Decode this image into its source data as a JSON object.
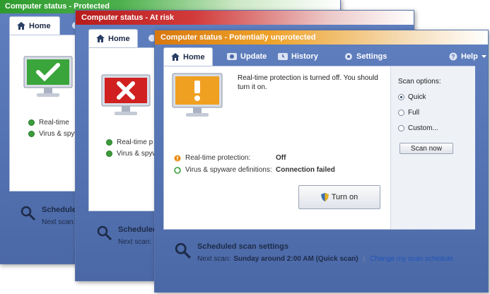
{
  "windows": {
    "protected": {
      "title": "Computer status - Protected",
      "tab_home": "Home",
      "rows": [
        "Real-time",
        "Virus & spyw"
      ],
      "scheduled": "Scheduled",
      "next_scan": "Next scan: S"
    },
    "at_risk": {
      "title": "Computer status - At risk",
      "tab_home": "Home",
      "rows": [
        "Real-time p",
        "Virus & spyw"
      ],
      "scheduled": "Scheduled s",
      "next_scan": "Next scan: S"
    },
    "unprotected": {
      "title": "Computer status - Potentially unprotected",
      "tabs": {
        "home": "Home",
        "update": "Update",
        "history": "History",
        "settings": "Settings",
        "help": "Help"
      },
      "message": "Real-time protection is turned off. You should turn it on.",
      "realtime_label": "Real-time protection:",
      "realtime_value": "Off",
      "defs_label": "Virus & spyware definitions:",
      "defs_value": "Connection failed",
      "turn_on": "Turn on",
      "scan_options": {
        "title": "Scan options:",
        "options": [
          "Quick",
          "Full",
          "Custom..."
        ],
        "selected": "Quick",
        "scan_now": "Scan now"
      },
      "scheduled_title": "Scheduled scan settings",
      "next_scan_label": "Next scan:",
      "next_scan_value": "Sunday around 2:00 AM (Quick scan)",
      "change_schedule": "Change my scan schedule"
    }
  },
  "colors": {
    "protected": "#3aa53a",
    "at_risk": "#d02020",
    "unprotected": "#f0a020",
    "frame": "#5a78b8"
  }
}
